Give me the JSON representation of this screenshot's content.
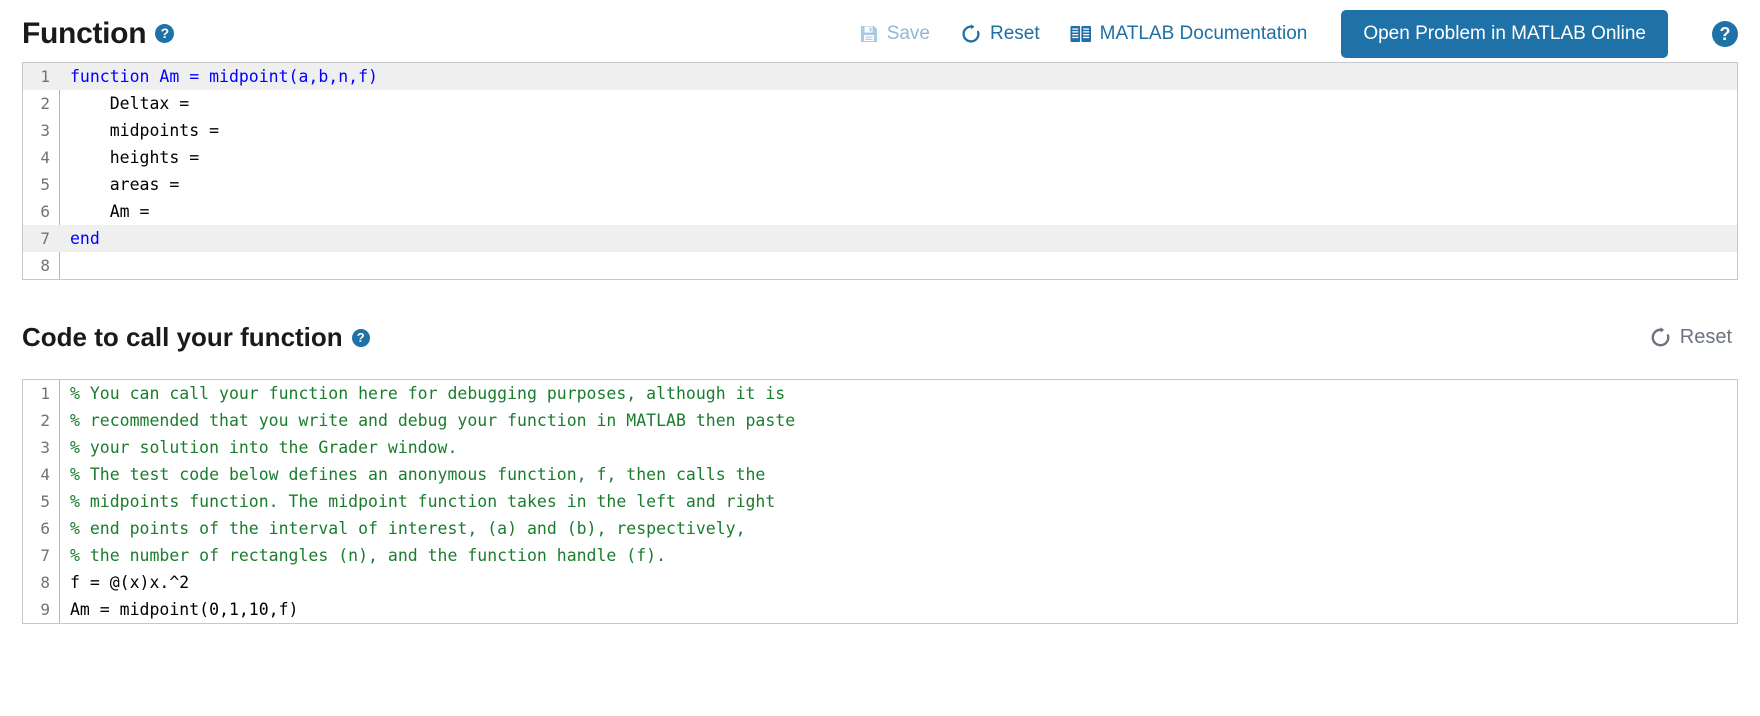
{
  "header": {
    "title": "Function",
    "help_icon": "question-mark-icon",
    "help_glyph": "?"
  },
  "toolbar": {
    "save_label": "Save",
    "save_icon": "save-floppy-icon",
    "save_disabled": true,
    "reset_label": "Reset",
    "reset_icon": "refresh-icon",
    "documentation_label": "MATLAB Documentation",
    "documentation_icon": "book-icon",
    "open_problem_label": "Open Problem in MATLAB Online",
    "page_help_glyph": "?",
    "page_help_icon": "question-mark-icon",
    "accent_color": "#1f72a8",
    "link_color": "#1f6fa5",
    "disabled_color": "#8fb9d6"
  },
  "function_editor": {
    "lines": [
      {
        "n": "1",
        "text": "function Am = midpoint(a,b,n,f)",
        "style": "kw",
        "highlight": true
      },
      {
        "n": "2",
        "text": "    Deltax =",
        "style": "plain",
        "highlight": false
      },
      {
        "n": "3",
        "text": "    midpoints =",
        "style": "plain",
        "highlight": false
      },
      {
        "n": "4",
        "text": "    heights =",
        "style": "plain",
        "highlight": false
      },
      {
        "n": "5",
        "text": "    areas =",
        "style": "plain",
        "highlight": false
      },
      {
        "n": "6",
        "text": "    Am =",
        "style": "plain",
        "highlight": false
      },
      {
        "n": "7",
        "text": "end",
        "style": "kw",
        "highlight": true
      },
      {
        "n": "8",
        "text": "",
        "style": "plain",
        "highlight": false
      }
    ]
  },
  "call_section": {
    "title": "Code to call your function",
    "help_glyph": "?",
    "help_icon": "question-mark-icon",
    "reset_label": "Reset",
    "reset_icon": "refresh-icon",
    "reset_color": "#6b7480"
  },
  "call_editor": {
    "lines": [
      {
        "n": "1",
        "text": "% You can call your function here for debugging purposes, although it is",
        "style": "cmt"
      },
      {
        "n": "2",
        "text": "% recommended that you write and debug your function in MATLAB then paste",
        "style": "cmt"
      },
      {
        "n": "3",
        "text": "% your solution into the Grader window.",
        "style": "cmt"
      },
      {
        "n": "4",
        "text": "% The test code below defines an anonymous function, f, then calls the",
        "style": "cmt"
      },
      {
        "n": "5",
        "text": "% midpoints function. The midpoint function takes in the left and right",
        "style": "cmt"
      },
      {
        "n": "6",
        "text": "% end points of the interval of interest, (a) and (b), respectively,",
        "style": "cmt"
      },
      {
        "n": "7",
        "text": "% the number of rectangles (n), and the function handle (f).",
        "style": "cmt"
      },
      {
        "n": "8",
        "text": "f = @(x)x.^2",
        "style": "plain"
      },
      {
        "n": "9",
        "text": "Am = midpoint(0,1,10,f)",
        "style": "plain"
      }
    ]
  },
  "colors": {
    "keyword": "#0000ff",
    "comment": "#1a7d2e",
    "highlight_band": "#efefef",
    "editor_border": "#c8c8c8",
    "gutter_text": "#737373"
  }
}
